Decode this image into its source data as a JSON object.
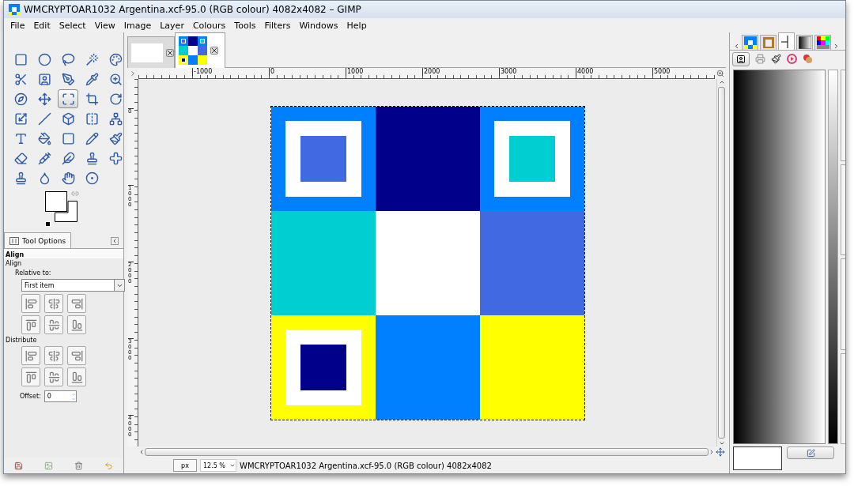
{
  "window": {
    "title": "WMCRYPTOAR1032 Argentina.xcf-95.0 (RGB colour) 4082x4082 – GIMP"
  },
  "menu": [
    "File",
    "Edit",
    "Select",
    "View",
    "Image",
    "Layer",
    "Colours",
    "Tools",
    "Filters",
    "Windows",
    "Help"
  ],
  "toolbox": {
    "tools": [
      {
        "selected": false
      },
      {
        "selected": false
      },
      {
        "selected": false
      },
      {
        "selected": false
      },
      {
        "selected": false
      },
      {
        "selected": false
      },
      {
        "selected": false
      },
      {
        "selected": false
      },
      {
        "selected": false
      },
      {
        "selected": false
      },
      {
        "selected": false
      },
      {
        "selected": false
      },
      {
        "selected": true
      },
      {
        "selected": false
      },
      {
        "selected": false
      },
      {
        "selected": false
      },
      {
        "selected": false
      },
      {
        "selected": false
      },
      {
        "selected": false
      },
      {
        "selected": false
      },
      {
        "selected": false
      },
      {
        "selected": false
      },
      {
        "selected": false
      },
      {
        "selected": false
      },
      {
        "selected": false
      },
      {
        "selected": false
      },
      {
        "selected": false
      },
      {
        "selected": false
      },
      {
        "selected": false
      },
      {
        "selected": false
      },
      {
        "selected": false
      },
      {
        "selected": false
      },
      {
        "selected": false
      },
      {
        "selected": false
      }
    ],
    "foreground": {
      "color": "#ffffff"
    },
    "background": {
      "color": "#ffffff"
    }
  },
  "tool_options": {
    "tab": "Tool Options",
    "title": "Align",
    "section": "Align",
    "relative_label": "Relative to:",
    "relative_value": "First item",
    "distribute_label": "Distribute",
    "offset_label": "Offset:",
    "offset_value": "0"
  },
  "image_tabs": [
    {
      "kind": "blank",
      "selected": false
    },
    {
      "kind": "thumbnail",
      "selected": true
    }
  ],
  "rulers": {
    "horizontal": [
      "-1000",
      "0",
      "1000",
      "2000",
      "3000",
      "4000",
      "5000"
    ],
    "vertical": [
      "0",
      "1000",
      "2000",
      "3000",
      "4000"
    ]
  },
  "image": {
    "cells": [
      {
        "color": "#0080ff",
        "inset": {
          "color": "#4169e1"
        }
      },
      {
        "color": "#00008b"
      },
      {
        "color": "#0080ff",
        "inset": {
          "color": "#00ced1"
        }
      },
      {
        "color": "#00ced1"
      },
      {
        "color": "#ffffff"
      },
      {
        "color": "#4169e1"
      },
      {
        "color": "#ffff00",
        "inset": {
          "color": "#00008b"
        }
      },
      {
        "color": "#0080ff"
      },
      {
        "color": "#ffff00"
      }
    ]
  },
  "status_bar": {
    "unit": "px",
    "zoom": "12.5 %",
    "info": "WMCRYPTOAR1032 Argentina.xcf-95.0 (RGB colour) 4082x4082"
  },
  "dock": {
    "tabs": [
      {
        "selected": false
      },
      {
        "selected": false
      },
      {
        "selected": true
      },
      {
        "selected": false
      },
      {
        "selected": false
      }
    ]
  }
}
